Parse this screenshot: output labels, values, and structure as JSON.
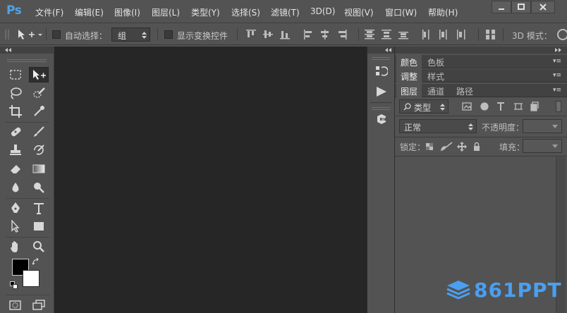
{
  "app": {
    "logo": "Ps"
  },
  "menu": [
    "文件(F)",
    "编辑(E)",
    "图像(I)",
    "图层(L)",
    "类型(Y)",
    "选择(S)",
    "滤镜(T)",
    "3D(D)",
    "视图(V)",
    "窗口(W)",
    "帮助(H)"
  ],
  "options": {
    "auto_select_label": "自动选择：",
    "auto_select_value": "组",
    "show_transform_label": "显示变换控件",
    "mode_3d_label": "3D 模式："
  },
  "panels": {
    "tabs_row1": [
      "颜色",
      "色板"
    ],
    "tabs_row2": [
      "调整",
      "样式"
    ],
    "tabs_row3": [
      "图层",
      "通道",
      "路径"
    ],
    "filter_kind": "类型",
    "blend_mode": "正常",
    "opacity_label": "不透明度：",
    "lock_label": "锁定：",
    "fill_label": "填充："
  },
  "watermark": "861PPT",
  "colors": {
    "accent": "#4fa3e6",
    "canvas": "#262626",
    "chrome": "#535353"
  }
}
